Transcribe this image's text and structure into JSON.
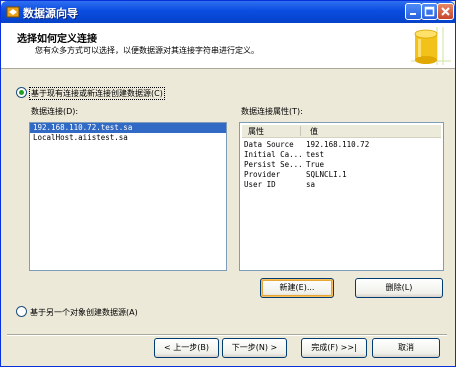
{
  "window": {
    "title": "数据源向导"
  },
  "header": {
    "title": "选择如何定义连接",
    "subtitle": "您有众多方式可以选择，以便数据源对其连接字符串进行定义。"
  },
  "options": {
    "existing_label": "基于现有连接或新连接创建数据源(C)",
    "other_object_label": "基于另一个对象创建数据源(A)"
  },
  "connections": {
    "label": "数据连接(D):",
    "items": [
      "192.168.110.72.test.sa",
      "LocalHost.aiistest.sa"
    ]
  },
  "properties": {
    "label": "数据连接属性(T):",
    "col_name": "属性",
    "col_value": "值",
    "rows": [
      {
        "name": "Data Source",
        "value": "192.168.110.72"
      },
      {
        "name": "Initial Ca...",
        "value": "test"
      },
      {
        "name": "Persist Se...",
        "value": "True"
      },
      {
        "name": "Provider",
        "value": "SQLNCLI.1"
      },
      {
        "name": "User ID",
        "value": "sa"
      }
    ]
  },
  "buttons": {
    "new": "新建(E)...",
    "delete": "删除(L)",
    "back": "< 上一步(B)",
    "next": "下一步(N) >",
    "finish": "完成(F) >>|",
    "cancel": "取消"
  },
  "colors": {
    "titlebar": "#0a4de0",
    "selection": "#316ac5",
    "dialog": "#ece9d8"
  }
}
